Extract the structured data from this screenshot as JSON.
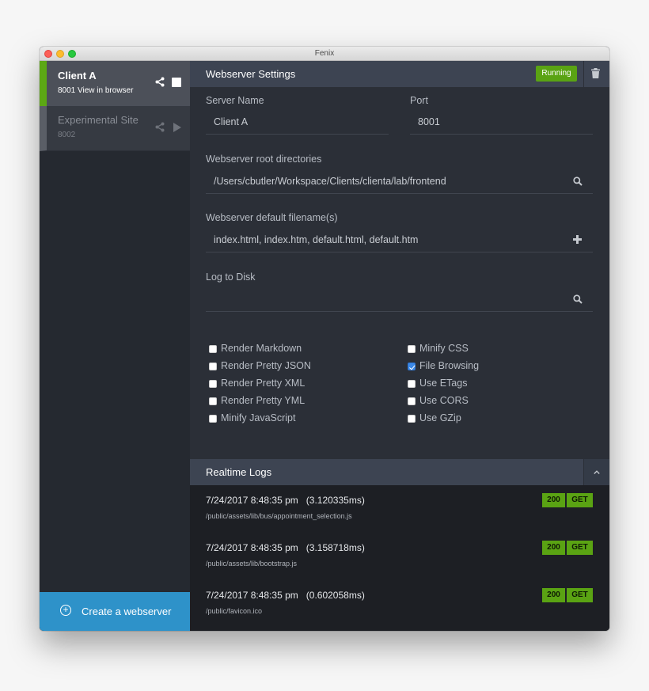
{
  "window": {
    "title": "Fenix"
  },
  "sidebar": {
    "sites": [
      {
        "name": "Client A",
        "port": "8001",
        "link_text": "View in browser"
      },
      {
        "name": "Experimental Site",
        "port": "8002"
      }
    ],
    "create_button_label": "Create a webserver"
  },
  "settings": {
    "title": "Webserver Settings",
    "status_badge": "Running",
    "server_name": {
      "label": "Server Name",
      "value": "Client A"
    },
    "port": {
      "label": "Port",
      "value": "8001"
    },
    "root_dirs": {
      "label": "Webserver root directories",
      "value": "/Users/cbutler/Workspace/Clients/clienta/lab/frontend"
    },
    "default_files": {
      "label": "Webserver default filename(s)",
      "value": "index.html, index.htm, default.html, default.htm"
    },
    "log_to_disk": {
      "label": "Log to Disk",
      "value": ""
    },
    "options_left": [
      {
        "label": "Render Markdown",
        "checked": false
      },
      {
        "label": "Render Pretty JSON",
        "checked": false
      },
      {
        "label": "Render Pretty XML",
        "checked": false
      },
      {
        "label": "Render Pretty YML",
        "checked": false
      },
      {
        "label": "Minify JavaScript",
        "checked": false
      }
    ],
    "options_right": [
      {
        "label": "Minify CSS",
        "checked": false
      },
      {
        "label": "File Browsing",
        "checked": true
      },
      {
        "label": "Use ETags",
        "checked": false
      },
      {
        "label": "Use CORS",
        "checked": false
      },
      {
        "label": "Use GZip",
        "checked": false
      }
    ]
  },
  "logs": {
    "title": "Realtime Logs",
    "entries": [
      {
        "time": "7/24/2017 8:48:35 pm",
        "duration": "(3.120335ms)",
        "path": "/public/assets/lib/bus/appointment_selection.js",
        "status": "200",
        "method": "GET"
      },
      {
        "time": "7/24/2017 8:48:35 pm",
        "duration": "(3.158718ms)",
        "path": "/public/assets/lib/bootstrap.js",
        "status": "200",
        "method": "GET"
      },
      {
        "time": "7/24/2017 8:48:35 pm",
        "duration": "(0.602058ms)",
        "path": "/public/favicon.ico",
        "status": "200",
        "method": "GET"
      }
    ]
  },
  "colors": {
    "accent_green": "#5aa313",
    "create_blue": "#2e92c9",
    "header_bg": "#3d4452",
    "checkbox_blue": "#3b89e8"
  }
}
